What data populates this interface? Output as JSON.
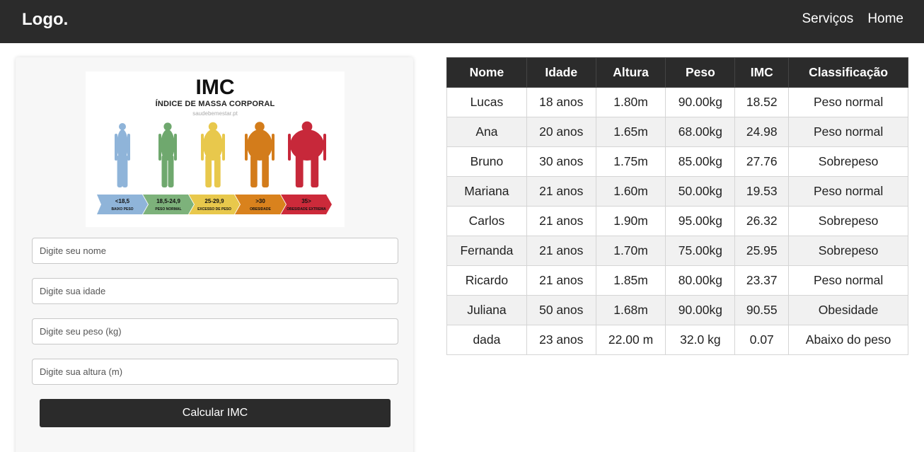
{
  "header": {
    "logo": "Logo.",
    "nav": [
      "Serviços",
      "Home"
    ]
  },
  "banner": {
    "title": "IMC",
    "subtitle": "ÍNDICE DE MASSA CORPORAL",
    "site": "saudebemestar.pt",
    "categories": [
      {
        "range": "<18,5",
        "label": "BAIXO PESO",
        "color": "#8fb4d9",
        "figure": "#8fb4d9"
      },
      {
        "range": "18,5-24,9",
        "label": "PESO NORMAL",
        "color": "#7db27b",
        "figure": "#6fa86e"
      },
      {
        "range": "25-29,9",
        "label": "EXCESSO DE PESO",
        "color": "#e8c84c",
        "figure": "#e8c84c"
      },
      {
        "range": ">30",
        "label": "OBESIDADE",
        "color": "#d9821d",
        "figure": "#d37c1b"
      },
      {
        "range": "35>",
        "label": "OBESIDADE EXTREMA",
        "color": "#cc2a3a",
        "figure": "#c7283a"
      }
    ]
  },
  "form": {
    "name_placeholder": "Digite seu nome",
    "age_placeholder": "Digite sua idade",
    "weight_placeholder": "Digite seu peso (kg)",
    "height_placeholder": "Digite sua altura (m)",
    "submit_label": "Calcular IMC"
  },
  "table": {
    "headers": [
      "Nome",
      "Idade",
      "Altura",
      "Peso",
      "IMC",
      "Classificação"
    ],
    "rows": [
      [
        "Lucas",
        "18 anos",
        "1.80m",
        "90.00kg",
        "18.52",
        "Peso normal"
      ],
      [
        "Ana",
        "20 anos",
        "1.65m",
        "68.00kg",
        "24.98",
        "Peso normal"
      ],
      [
        "Bruno",
        "30 anos",
        "1.75m",
        "85.00kg",
        "27.76",
        "Sobrepeso"
      ],
      [
        "Mariana",
        "21 anos",
        "1.60m",
        "50.00kg",
        "19.53",
        "Peso normal"
      ],
      [
        "Carlos",
        "21 anos",
        "1.90m",
        "95.00kg",
        "26.32",
        "Sobrepeso"
      ],
      [
        "Fernanda",
        "21 anos",
        "1.70m",
        "75.00kg",
        "25.95",
        "Sobrepeso"
      ],
      [
        "Ricardo",
        "21 anos",
        "1.85m",
        "80.00kg",
        "23.37",
        "Peso normal"
      ],
      [
        "Juliana",
        "50 anos",
        "1.68m",
        "90.00kg",
        "90.55",
        "Obesidade"
      ],
      [
        "dada",
        "23 anos",
        "22.00 m",
        "32.0 kg",
        "0.07",
        "Abaixo do peso"
      ]
    ]
  }
}
